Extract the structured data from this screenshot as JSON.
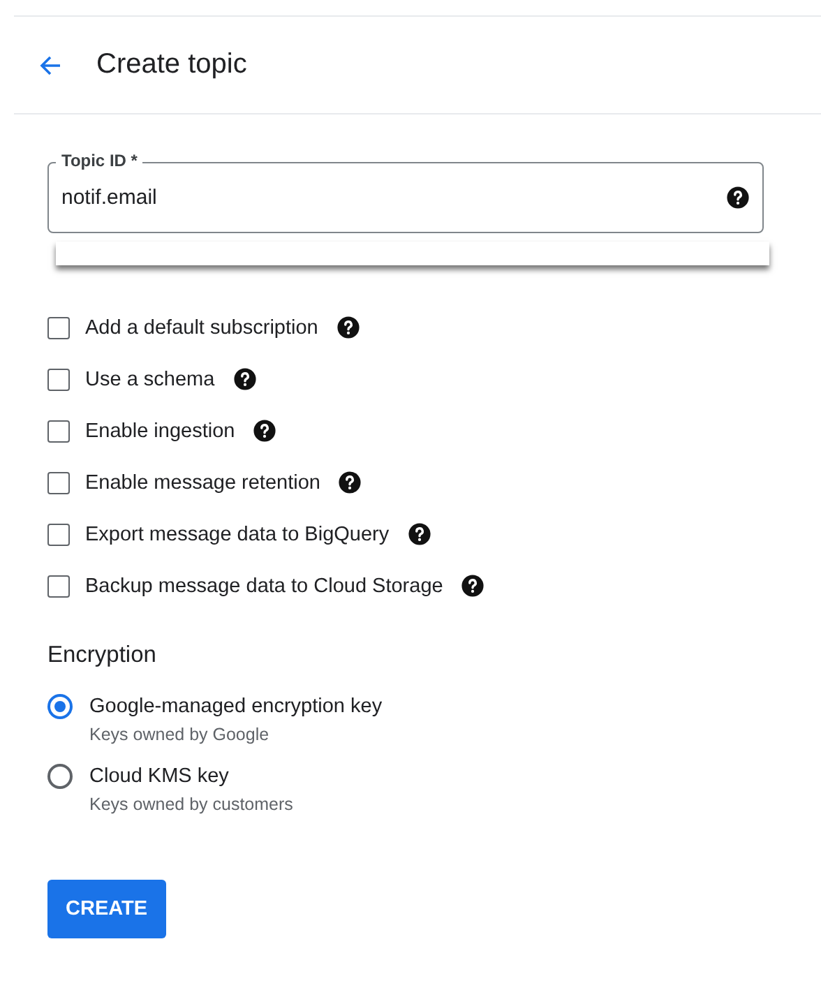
{
  "header": {
    "title": "Create topic"
  },
  "topic_field": {
    "label": "Topic ID *",
    "value": "notif.email"
  },
  "options": [
    {
      "label": "Add a default subscription",
      "checked": false
    },
    {
      "label": "Use a schema",
      "checked": false
    },
    {
      "label": "Enable ingestion",
      "checked": false
    },
    {
      "label": "Enable message retention",
      "checked": false
    },
    {
      "label": "Export message data to BigQuery",
      "checked": false
    },
    {
      "label": "Backup message data to Cloud Storage",
      "checked": false
    }
  ],
  "encryption": {
    "heading": "Encryption",
    "choices": [
      {
        "label": "Google-managed encryption key",
        "description": "Keys owned by Google",
        "selected": true
      },
      {
        "label": "Cloud KMS key",
        "description": "Keys owned by customers",
        "selected": false
      }
    ]
  },
  "create_button": "CREATE"
}
